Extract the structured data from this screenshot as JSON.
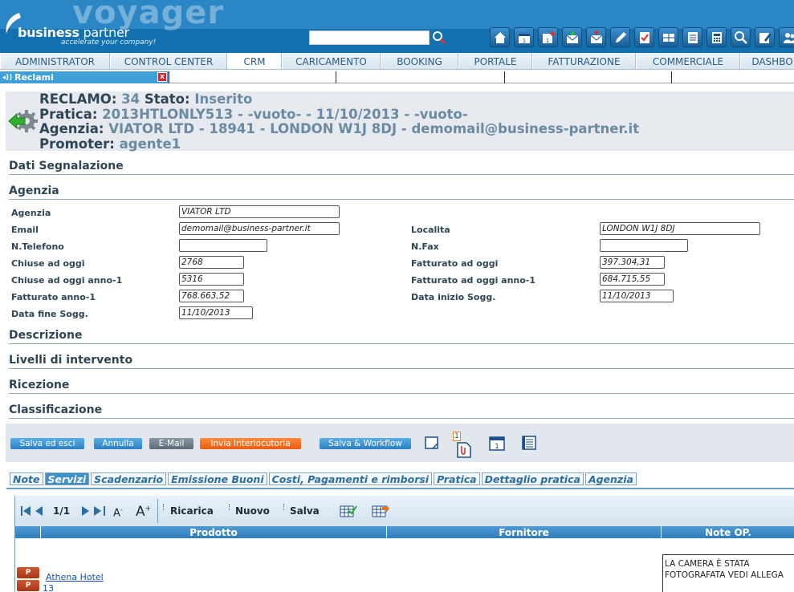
{
  "header": {
    "brand_big": "voyager",
    "brand_name_bold": "business",
    "brand_name_light": " partner",
    "tagline": "accelerate your company!",
    "search_value": "",
    "icons": [
      "home-icon",
      "calendar-icon",
      "calendar-add-icon",
      "mail-in-icon",
      "mail-out-icon",
      "pencil-icon",
      "checklist-icon",
      "columns-icon",
      "document-icon",
      "calculator-icon",
      "search-icon",
      "edit-notes-icon",
      "users-icon"
    ]
  },
  "nav": {
    "tabs": [
      "ADMINISTRATOR",
      "CONTROL CENTER",
      "CRM",
      "CARICAMENTO",
      "BOOKING",
      "PORTALE",
      "FATTURAZIONE",
      "COMMERCIALE",
      "DASHBO"
    ],
    "active": "CRM"
  },
  "window_tab": {
    "label": "Reclami",
    "close": "x"
  },
  "reclamo": {
    "l1_label": "RECLAMO:",
    "l1_value": "34",
    "l1_label2": "Stato:",
    "l1_value2": "Inserito",
    "l2_label": "Pratica:",
    "l2_value": "2013HTLONLY513 - -vuoto- - 11/10/2013 - -vuoto-",
    "l3_label": "Agenzia:",
    "l3_value": "VIATOR LTD - 18941 - LONDON W1J 8DJ - demomail@business-partner.it",
    "l4_label": "Promoter:",
    "l4_value": "agente1"
  },
  "sections": {
    "dati_segnalazione": "Dati Segnalazione",
    "agenzia": "Agenzia",
    "descrizione": "Descrizione",
    "livelli": "Livelli di intervento",
    "ricezione": "Ricezione",
    "classificazione": "Classificazione"
  },
  "form": {
    "agenzia_label": "Agenzia",
    "agenzia_value": "VIATOR LTD",
    "email_label": "Email",
    "email_value": "demomail@business-partner.it",
    "localita_label": "Localita",
    "localita_value": "LONDON W1J 8DJ",
    "telefono_label": "N.Telefono",
    "telefono_value": "",
    "fax_label": "N.Fax",
    "fax_value": "",
    "chiuse_label": "Chiuse ad oggi",
    "chiuse_value": "2768",
    "fatturato_label": "Fatturato ad oggi",
    "fatturato_value": "397.304,31",
    "chiuse1_label": "Chiuse ad oggi anno-1",
    "chiuse1_value": "5316",
    "fatturato1_label": "Fatturato ad oggi anno-1",
    "fatturato1_value": "684.715,55",
    "fattanno_label": "Fatturato anno-1",
    "fattanno_value": "768.663,52",
    "datainizio_label": "Data inizio Sogg.",
    "datainizio_value": "11/10/2013",
    "datafine_label": "Data fine Sogg.",
    "datafine_value": "11/10/2013"
  },
  "actions": {
    "salva_esci": "Salva ed esci",
    "annulla": "Annulla",
    "email": "E-Mail",
    "invia": "Invia Interlocutoria",
    "salva_workflow": "Salva & Workflow",
    "attachment_count": "1"
  },
  "subtabs": {
    "items": [
      "Note",
      "Servizi",
      "Scadenzario",
      "Emissione Buoni",
      "Costi, Pagamenti e rimborsi",
      "Pratica",
      "Dettaglio pratica",
      "Agenzia"
    ],
    "active": "Servizi"
  },
  "grid": {
    "pager": "1/1",
    "ricarica": "Ricarica",
    "nuovo": "Nuovo",
    "salva": "Salva",
    "col_prodotto": "Prodotto",
    "col_fornitore": "Fornitore",
    "col_note": "Note OP.",
    "badge": "P",
    "row_product": "Athena Hotel",
    "row_num": "13",
    "row_note_line1": "LA CAMERA È STATA",
    "row_note_line2": "FOTOGRAFATA VEDI ALLEGA"
  }
}
